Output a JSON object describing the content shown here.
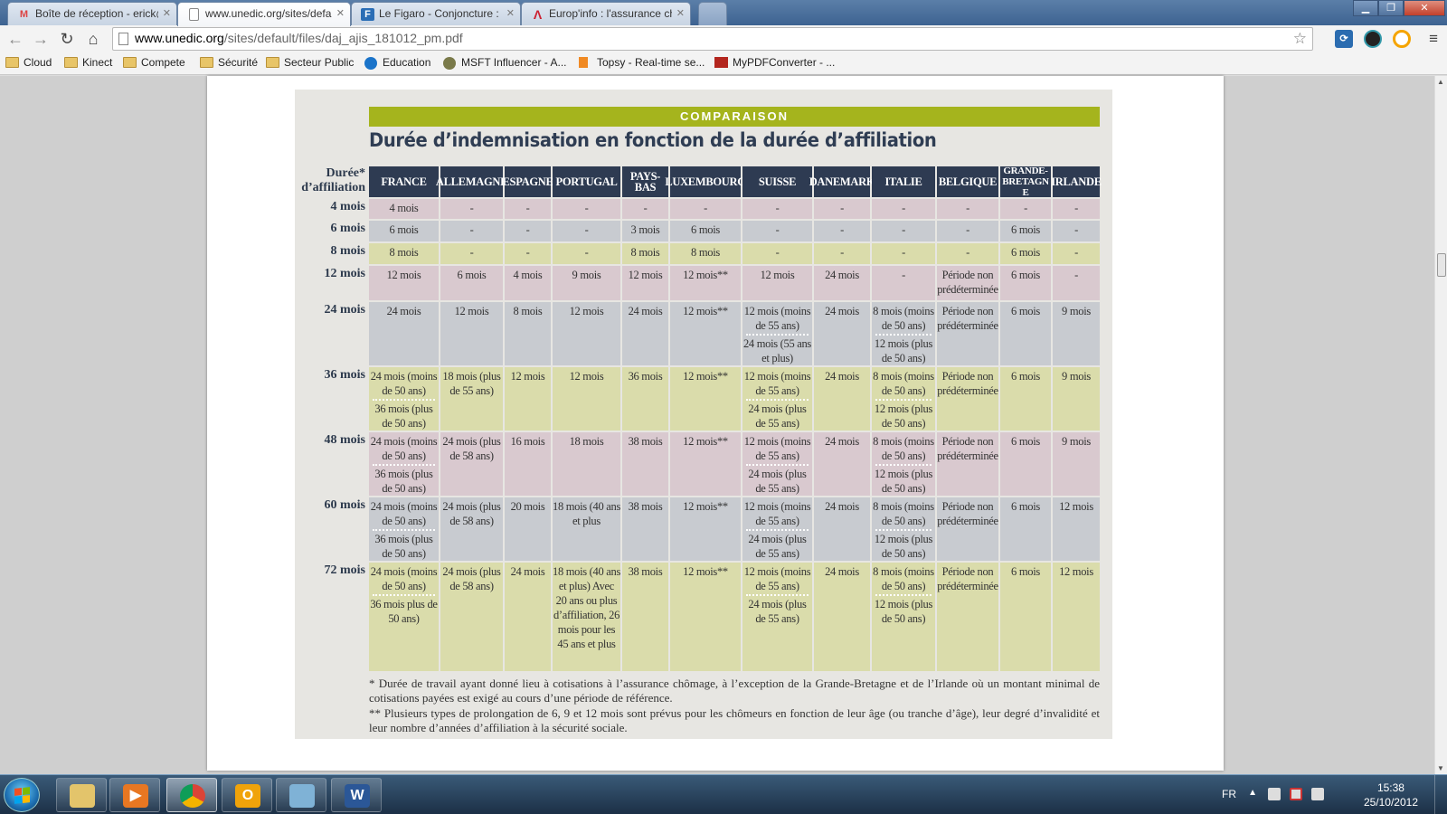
{
  "browser": {
    "tabs": [
      {
        "label": "Boîte de réception - erick@",
        "icon": "gmail-icon"
      },
      {
        "label": "www.unedic.org/sites/defa",
        "icon": "page-icon"
      },
      {
        "label": "Le Figaro - Conjoncture : L",
        "icon": "figaro-icon"
      },
      {
        "label": "Europ'info : l'assurance ch",
        "icon": "europinfo-icon"
      }
    ],
    "url_host": "www.unedic.org",
    "url_path": "/sites/default/files/daj_ajis_181012_pm.pdf",
    "bookmarks": [
      {
        "label": "Cloud",
        "icon": "folder-icon"
      },
      {
        "label": "Kinect",
        "icon": "folder-icon"
      },
      {
        "label": "Compete",
        "icon": "folder-icon"
      },
      {
        "label": "Sécurité",
        "icon": "folder-icon"
      },
      {
        "label": "Secteur Public",
        "icon": "folder-icon"
      },
      {
        "label": "Education",
        "icon": "star-badge-icon"
      },
      {
        "label": "MSFT Influencer - A...",
        "icon": "s-circle-icon"
      },
      {
        "label": "Topsy - Real-time se...",
        "icon": "topsy-icon"
      },
      {
        "label": "MyPDFConverter - ...",
        "icon": "pdf-icon"
      }
    ]
  },
  "figure": {
    "banner": "COMPARAISON",
    "title": "Durée d’indemnisation en fonction de la durée d’affiliation",
    "row_header": [
      "Durée*",
      "d’affiliation"
    ],
    "columns": [
      "FRANCE",
      "ALLEMAGNE",
      "ESPAGNE",
      "PORTUGAL",
      "PAYS-BAS",
      "LUXEMBOURG",
      "SUISSE",
      "DANEMARK",
      "ITALIE",
      "BELGIQUE",
      "GRANDE-BRETAGNE",
      "IRLANDE"
    ],
    "rows": [
      {
        "label": "4 mois",
        "color": "pink",
        "cells": [
          [
            "4 mois"
          ],
          [
            "-"
          ],
          [
            "-"
          ],
          [
            "-"
          ],
          [
            "-"
          ],
          [
            "-"
          ],
          [
            "-"
          ],
          [
            "-"
          ],
          [
            "-"
          ],
          [
            "-"
          ],
          [
            "-"
          ],
          [
            "-"
          ]
        ]
      },
      {
        "label": "6 mois",
        "color": "grey",
        "cells": [
          [
            "6 mois"
          ],
          [
            "-"
          ],
          [
            "-"
          ],
          [
            "-"
          ],
          [
            "3 mois"
          ],
          [
            "6 mois"
          ],
          [
            "-"
          ],
          [
            "-"
          ],
          [
            "-"
          ],
          [
            "-"
          ],
          [
            "6 mois"
          ],
          [
            "-"
          ]
        ]
      },
      {
        "label": "8 mois",
        "color": "green",
        "cells": [
          [
            "8 mois"
          ],
          [
            "-"
          ],
          [
            "-"
          ],
          [
            "-"
          ],
          [
            "8 mois"
          ],
          [
            "8 mois"
          ],
          [
            "-"
          ],
          [
            "-"
          ],
          [
            "-"
          ],
          [
            "-"
          ],
          [
            "6 mois"
          ],
          [
            "-"
          ]
        ]
      },
      {
        "label": "12 mois",
        "color": "pink",
        "cells": [
          [
            "12 mois"
          ],
          [
            "6 mois"
          ],
          [
            "4 mois"
          ],
          [
            "9 mois"
          ],
          [
            "12 mois"
          ],
          [
            "12 mois**"
          ],
          [
            "12 mois"
          ],
          [
            "24 mois"
          ],
          [
            "-"
          ],
          [
            "Période non prédéterminée"
          ],
          [
            "6 mois"
          ],
          [
            "-"
          ]
        ]
      },
      {
        "label": "24 mois",
        "color": "grey",
        "cells": [
          [
            "24 mois"
          ],
          [
            "12 mois"
          ],
          [
            "8 mois"
          ],
          [
            "12 mois"
          ],
          [
            "24 mois"
          ],
          [
            "12 mois**"
          ],
          [
            "12 mois (moins de 55 ans)",
            "24 mois (55 ans et plus)"
          ],
          [
            "24 mois"
          ],
          [
            "8 mois (moins de 50 ans)",
            "12 mois (plus de 50 ans)"
          ],
          [
            "Période non prédéterminée"
          ],
          [
            "6 mois"
          ],
          [
            "9 mois"
          ]
        ]
      },
      {
        "label": "36 mois",
        "color": "green",
        "cells": [
          [
            "24 mois (moins de 50 ans)",
            "36 mois (plus de 50 ans)"
          ],
          [
            "18 mois (plus de 55 ans)"
          ],
          [
            "12 mois"
          ],
          [
            "12 mois"
          ],
          [
            "36 mois"
          ],
          [
            "12 mois**"
          ],
          [
            "12 mois (moins de 55 ans)",
            "24 mois (plus de 55 ans)"
          ],
          [
            "24 mois"
          ],
          [
            "8 mois (moins de 50 ans)",
            "12 mois (plus de 50 ans)"
          ],
          [
            "Période non prédéterminée"
          ],
          [
            "6 mois"
          ],
          [
            "9 mois"
          ]
        ]
      },
      {
        "label": "48 mois",
        "color": "pink",
        "cells": [
          [
            "24 mois (moins de 50 ans)",
            "36 mois (plus de 50 ans)"
          ],
          [
            "24 mois (plus de 58 ans)"
          ],
          [
            "16 mois"
          ],
          [
            "18 mois"
          ],
          [
            "38 mois"
          ],
          [
            "12 mois**"
          ],
          [
            "12 mois (moins de 55 ans)",
            "24 mois (plus de 55 ans)"
          ],
          [
            "24 mois"
          ],
          [
            "8 mois (moins de 50 ans)",
            "12 mois (plus de 50 ans)"
          ],
          [
            "Période non prédéterminée"
          ],
          [
            "6 mois"
          ],
          [
            "9 mois"
          ]
        ]
      },
      {
        "label": "60 mois",
        "color": "grey",
        "cells": [
          [
            "24 mois (moins de 50 ans)",
            "36 mois (plus de 50 ans)"
          ],
          [
            "24 mois (plus de 58 ans)"
          ],
          [
            "20 mois"
          ],
          [
            "18 mois (40 ans et plus"
          ],
          [
            "38 mois"
          ],
          [
            "12 mois**"
          ],
          [
            "12 mois (moins de 55 ans)",
            "24 mois (plus de 55 ans)"
          ],
          [
            "24 mois"
          ],
          [
            "8 mois (moins de 50 ans)",
            "12 mois (plus de 50 ans)"
          ],
          [
            "Période non prédéterminée"
          ],
          [
            "6 mois"
          ],
          [
            "12 mois"
          ]
        ]
      },
      {
        "label": "72 mois",
        "color": "green",
        "cells": [
          [
            "24 mois (moins de 50 ans)",
            "36 mois plus de 50 ans)"
          ],
          [
            "24 mois (plus de 58 ans)"
          ],
          [
            "24 mois"
          ],
          [
            "18 mois (40 ans et plus) Avec 20 ans ou plus d’affiliation, 26 mois pour les 45 ans et plus"
          ],
          [
            "38 mois"
          ],
          [
            "12 mois**"
          ],
          [
            "12 mois (moins de 55 ans)",
            "24 mois (plus de 55 ans)"
          ],
          [
            "24 mois"
          ],
          [
            "8 mois (moins de 50 ans)",
            "12 mois (plus de 50 ans)"
          ],
          [
            "Période non prédéterminée"
          ],
          [
            "6 mois"
          ],
          [
            "12 mois"
          ]
        ]
      }
    ],
    "footnote_1": "* Durée de travail ayant donné lieu à cotisations à l’assurance chômage, à l’exception de la Grande-Bretagne et de l’Irlande où un montant minimal de cotisations payées est exigé au cours d’une période de référence.",
    "footnote_2": "** Plusieurs types de prolongation de 6, 9 et 12 mois sont prévus pour les chômeurs en fonction de leur âge (ou tranche d’âge), leur degré d’invalidité et leur nombre d’années d’affiliation à la sécurité sociale."
  },
  "taskbar": {
    "apps": [
      {
        "name": "explorer",
        "icon": "folder-icon"
      },
      {
        "name": "media-player",
        "icon": "media-player-icon"
      },
      {
        "name": "chrome",
        "icon": "chrome-icon"
      },
      {
        "name": "outlook",
        "icon": "outlook-icon"
      },
      {
        "name": "app-blue",
        "icon": "app-icon"
      },
      {
        "name": "word",
        "icon": "word-icon"
      }
    ],
    "language": "FR",
    "time": "15:38",
    "date": "25/10/2012"
  },
  "colors": {
    "banner": "#a5b41d",
    "header": "#2e3b52",
    "row_pink": "#d9c9cf",
    "row_grey": "#c8cbd0",
    "row_green": "#dadcab"
  }
}
